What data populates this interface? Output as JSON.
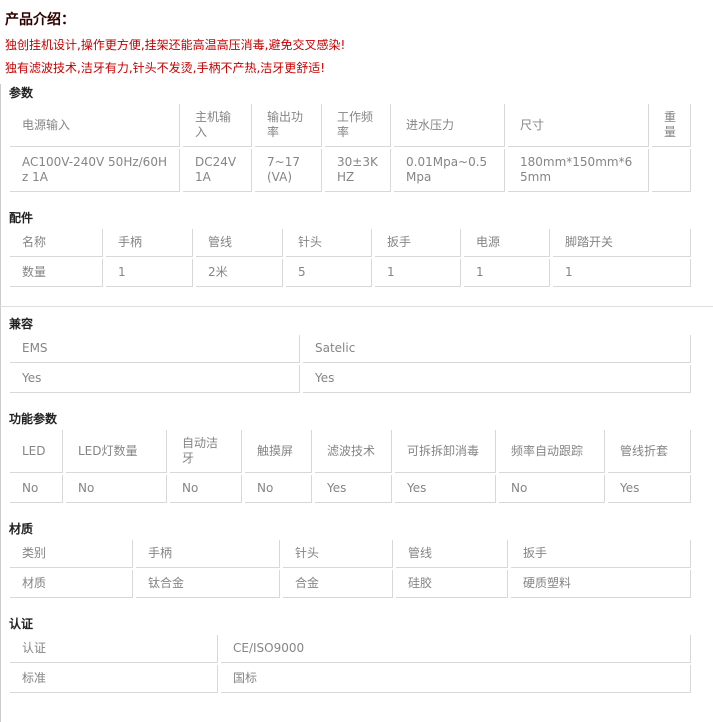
{
  "page": {
    "title": "产品介绍：",
    "description_lines": [
      "独创挂机设计,操作更方便,挂架还能高温高压消毒,避免交叉感染!",
      "独有滤波技术,洁牙有力,针头不发烫,手柄不产热,洁牙更舒适!"
    ]
  },
  "colors": {
    "accent_red": "#c60000",
    "table_border": "#d8d8d8",
    "cell_text": "#858585"
  },
  "sections": {
    "params": {
      "title": "参数",
      "header": [
        "电源输入",
        "主机输入",
        "输出功率",
        "工作频率",
        "进水压力",
        "尺寸",
        "重量"
      ],
      "values": [
        "AC100V-240V 50Hz/60Hz 1A",
        "DC24V 1A",
        "7~17(VA)",
        "30±3KHZ",
        "0.01Mpa~0.5Mpa",
        "180mm*150mm*65mm",
        ""
      ]
    },
    "accessories": {
      "title": "配件",
      "header": [
        "名称",
        "手柄",
        "管线",
        "针头",
        "扳手",
        "电源",
        "脚踏开关"
      ],
      "values": [
        "数量",
        "1",
        "2米",
        "5",
        "1",
        "1",
        "1"
      ]
    },
    "compat": {
      "title": "兼容",
      "header": [
        "EMS",
        "Satelic"
      ],
      "values": [
        "Yes",
        "Yes"
      ]
    },
    "features": {
      "title": "功能参数",
      "header": [
        "LED",
        "LED灯数量",
        "自动洁牙",
        "触摸屏",
        "滤波技术",
        "可拆拆卸消毒",
        "频率自动跟踪",
        "管线折套"
      ],
      "values": [
        "No",
        "No",
        "No",
        "No",
        "Yes",
        "Yes",
        "No",
        "Yes"
      ]
    },
    "materials": {
      "title": "材质",
      "header": [
        "类别",
        "手柄",
        "针头",
        "管线",
        "扳手"
      ],
      "values": [
        "材质",
        "钛合金",
        "合金",
        "硅胶",
        "硬质塑料"
      ]
    },
    "cert": {
      "title": "认证",
      "header": [
        "认证",
        "CE/ISO9000"
      ],
      "values": [
        "标准",
        "国标"
      ]
    }
  }
}
